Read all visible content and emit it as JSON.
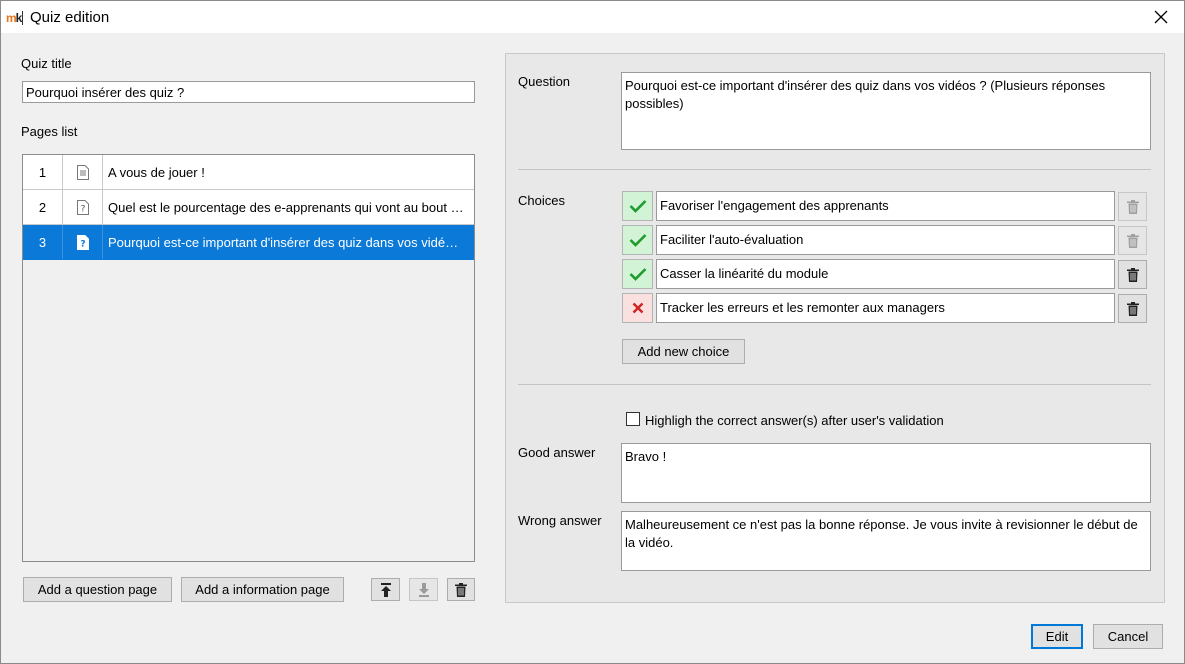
{
  "window": {
    "title": "Quiz edition",
    "logo_text_m": "m",
    "logo_text_k": "k"
  },
  "left": {
    "quiz_title_label": "Quiz title",
    "quiz_title_value": "Pourquoi insérer des quiz ?",
    "pages_list_label": "Pages list",
    "pages": [
      {
        "num": "1",
        "icon": "text-page-icon",
        "text": "A vous de jouer !"
      },
      {
        "num": "2",
        "icon": "question-page-icon",
        "text": "Quel est le pourcentage des e-apprenants qui vont au bout des modules"
      },
      {
        "num": "3",
        "icon": "question-page-icon",
        "text": "Pourquoi est-ce important d'insérer des quiz dans vos vidéos ? (Plusieurs réponses possibles)"
      }
    ],
    "add_question_label": "Add a question page",
    "add_information_label": "Add a information page"
  },
  "right": {
    "question_label": "Question",
    "question_value": "Pourquoi est-ce important d'insérer des quiz dans vos vidéos ? (Plusieurs réponses possibles)",
    "choices_label": "Choices",
    "choices": [
      {
        "correct": true,
        "text": "Favoriser l'engagement des apprenants"
      },
      {
        "correct": true,
        "text": "Faciliter l'auto-évaluation"
      },
      {
        "correct": true,
        "text": "Casser la linéarité du module"
      },
      {
        "correct": false,
        "text": "Tracker les erreurs et les remonter aux managers"
      }
    ],
    "add_choice_label": "Add new choice",
    "highlight_label": "Highligh the correct answer(s) after user's validation",
    "highlight_checked": false,
    "good_answer_label": "Good answer",
    "good_answer_value": "Bravo !",
    "wrong_answer_label": "Wrong answer",
    "wrong_answer_value": "Malheureusement ce n'est pas la bonne réponse. Je vous invite à revisionner le début de la vidéo."
  },
  "footer": {
    "edit_label": "Edit",
    "cancel_label": "Cancel"
  },
  "colors": {
    "selection": "#0a79d8",
    "check_green": "#1e9c2e",
    "cross_red": "#d02525"
  }
}
